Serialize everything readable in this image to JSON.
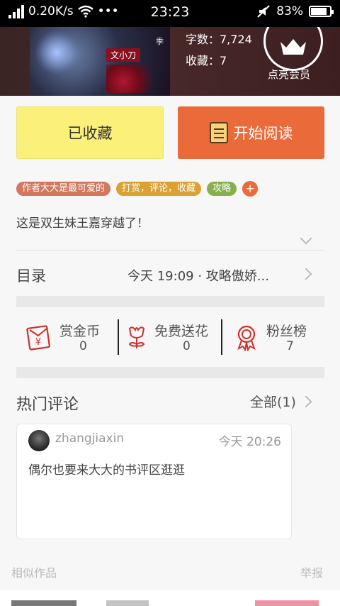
{
  "status_bar": {
    "net_speed": "0.20K/s",
    "dots": "•••",
    "time": "23:23",
    "battery": "83%",
    "battery_level": 0.83
  },
  "book": {
    "word_count": "字数：7,724",
    "favorites": "收藏：7",
    "cover_author": "文小刀",
    "cover_season": "季",
    "vip_label": "点亮会员"
  },
  "buttons": {
    "favorited": "已收藏",
    "start_reading": "开始阅读"
  },
  "tags": [
    {
      "label": "作者大大是最可爱的",
      "color": "#d4775f"
    },
    {
      "label": "打赏，评论，收藏",
      "color": "#d9a233"
    },
    {
      "label": "攻略",
      "color": "#86b04b"
    }
  ],
  "tag_add": "+",
  "description": "这是双生妹王嘉穿越了！",
  "toc": {
    "label": "目录",
    "latest": "今天 19:09 · 攻略傲娇..."
  },
  "actions": [
    {
      "label": "赏金币",
      "count": "0",
      "icon": "coin-envelope-icon"
    },
    {
      "label": "免费送花",
      "count": "0",
      "icon": "flower-icon"
    },
    {
      "label": "粉丝榜",
      "count": "7",
      "icon": "medal-icon"
    }
  ],
  "comments": {
    "title": "热门评论",
    "all_link": "全部(1)",
    "items": [
      {
        "user": "zhangjiaxin",
        "time": "今天 20:26",
        "text": "偶尔也要来大大的书评区逛逛"
      }
    ]
  },
  "footer": {
    "similar": "相似作品",
    "report": "举报"
  },
  "colors": {
    "accent_orange": "#ea6a3a",
    "fav_yellow": "#fbf07a",
    "action_red": "#d0302a"
  }
}
